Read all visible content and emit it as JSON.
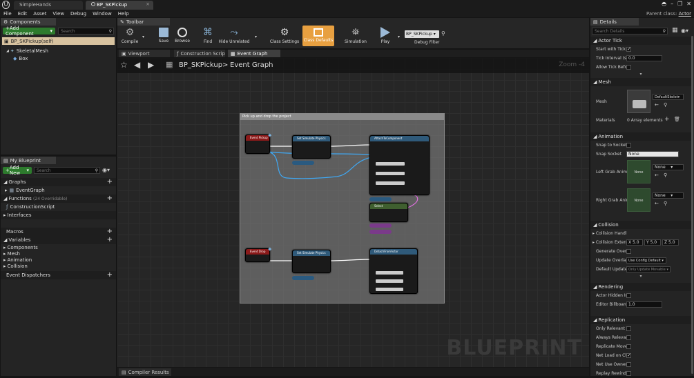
{
  "window": {
    "tabs": [
      {
        "label": "SimpleHands"
      },
      {
        "label": "BP_SKPickup"
      }
    ],
    "parent_class_label": "Parent class:",
    "parent_class_value": "Actor"
  },
  "menu": [
    "File",
    "Edit",
    "Asset",
    "View",
    "Debug",
    "Window",
    "Help"
  ],
  "components": {
    "tab_label": "Components",
    "add_button": "+Add Component",
    "search_placeholder": "Search",
    "items": [
      "BP_SKPickup(self)",
      "SkeletalMesh",
      "Box"
    ]
  },
  "my_blueprint": {
    "tab_label": "My Blueprint",
    "add_button": "Add New",
    "search_placeholder": "Search",
    "sections": {
      "graphs": "Graphs",
      "event_graph": "EventGraph",
      "functions": "Functions",
      "functions_count": "(24 Overridable)",
      "construction_script": "ConstructionScript",
      "interfaces": "Interfaces",
      "macros": "Macros",
      "variables": "Variables",
      "var_components": "Components",
      "var_mesh": "Mesh",
      "var_animation": "Animation",
      "var_collision": "Collision",
      "event_dispatchers": "Event Dispatchers"
    }
  },
  "toolbar": {
    "tab_label": "Toolbar",
    "compile": "Compile",
    "save": "Save",
    "browse": "Browse",
    "find": "Find",
    "hide_unrelated": "Hide Unrelated",
    "class_settings": "Class Settings",
    "class_defaults": "Class Defaults",
    "simulation": "Simulation",
    "play": "Play",
    "debug_selector": "BP_SKPickup",
    "debug_filter": "Debug Filter"
  },
  "editor_tabs": [
    "Viewport",
    "Construction Scrip",
    "Event Graph"
  ],
  "graph": {
    "breadcrumb_root": "BP_SKPickup",
    "breadcrumb_sep": ">",
    "breadcrumb_current": "Event Graph",
    "zoom": "Zoom -4",
    "comment": "Pick up and drop the project",
    "watermark": "BLUEPRINT",
    "nodes": {
      "event_pickup": "Event Pickup",
      "event_drop": "Event Drop",
      "set_sim_1": "Set Simulate Physics",
      "set_sim_2": "Set Simulate Physics",
      "attach": "AttachToComponent",
      "detach": "DetachFromActor",
      "select": "Select"
    }
  },
  "compiler_results": "Compiler Results",
  "details": {
    "tab_label": "Details",
    "search_placeholder": "Search Details",
    "actor_tick": {
      "header": "Actor Tick",
      "start_with_tick": "Start with Tick",
      "tick_interval": "Tick Interval (s",
      "tick_interval_value": "0.0",
      "allow_tick": "Allow Tick Befo"
    },
    "mesh": {
      "header": "Mesh",
      "mesh_label": "Mesh",
      "mesh_value": "DefaultSkelet",
      "materials_label": "Materials",
      "materials_value": "0 Array elements"
    },
    "animation": {
      "header": "Animation",
      "snap_to_socket": "Snap to Socket",
      "snap_socket": "Snap Socket",
      "snap_socket_value": "None",
      "left_grab": "Left Grab Anim",
      "right_grab": "Right Grab Anim",
      "none": "None"
    },
    "collision": {
      "header": "Collision",
      "collision_handle": "Collision Handl",
      "collision_extent": "Collision Exten",
      "x": "X 5.0",
      "y": "Y 5.0",
      "z": "Z 5.0",
      "generate_overlap": "Generate Overl",
      "update_overlap": "Update Overlap",
      "update_overlap_value": "Use Config Default",
      "default_update": "Default Update",
      "default_update_value": "Only Update Movable"
    },
    "rendering": {
      "header": "Rendering",
      "actor_hidden": "Actor Hidden In",
      "editor_billboard": "Editor Billboard",
      "editor_billboard_value": "1.0"
    },
    "replication": {
      "header": "Replication",
      "only_relevant": "Only Relevant T",
      "always_relevant": "Always Relevar",
      "replicate_move": "Replicate Move",
      "net_load": "Net Load on Cli",
      "net_use_owner": "Net Use Owner",
      "replay_rewinds": "Replay Rewinds"
    }
  },
  "colors": {
    "accent_orange": "#e8a040",
    "event_red": "#8b1a1a",
    "function_blue": "#2f5a7a",
    "exec_white": "#ffffff",
    "object_cyan": "#3fa9f5"
  }
}
